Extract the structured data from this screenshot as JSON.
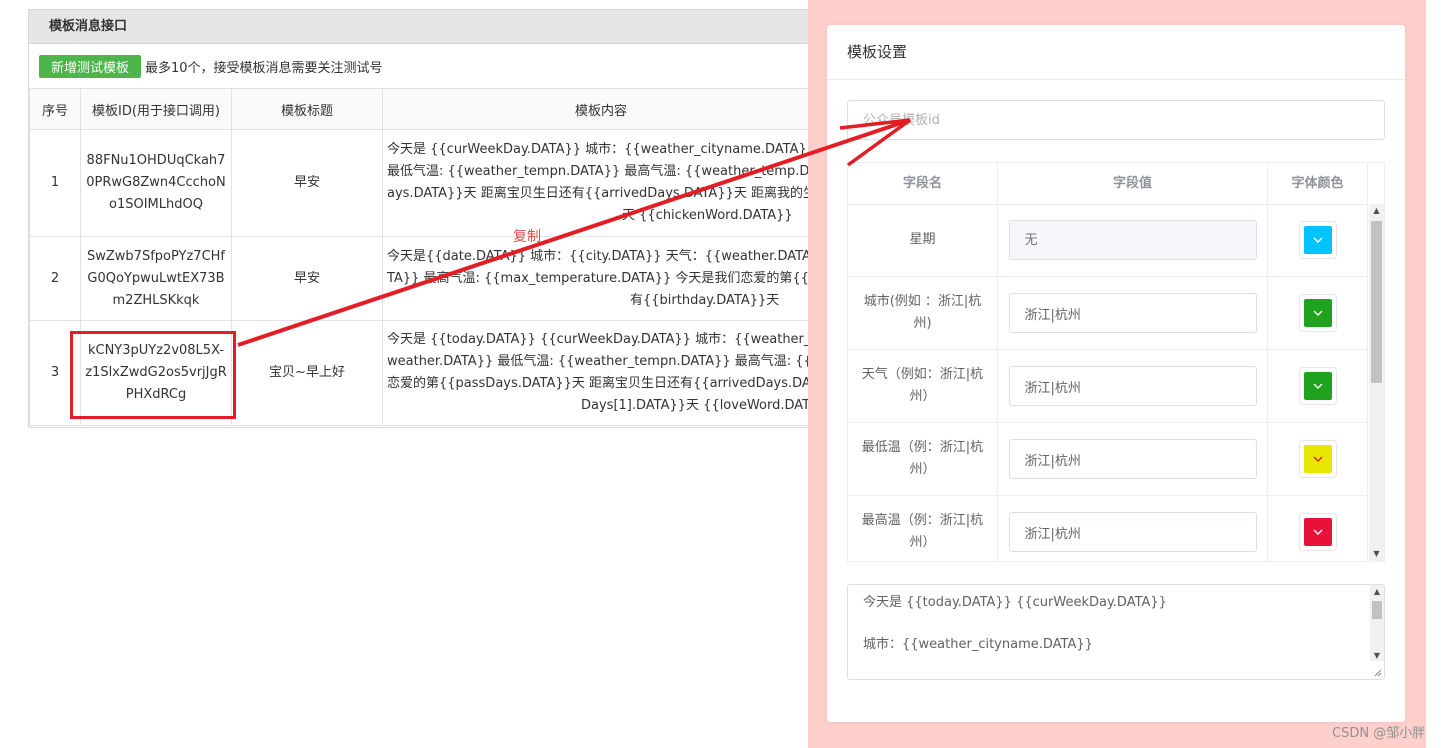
{
  "left": {
    "title": "模板消息接口",
    "add_button": "新增测试模板",
    "tip": "最多10个，接受模板消息需要关注测试号",
    "columns": [
      "序号",
      "模板ID(用于接口调用)",
      "模板标题",
      "模板内容"
    ],
    "rows": [
      {
        "no": "1",
        "id": "88FNu1OHDUqCkah70PRwG8Zwn4CcchoNo1SOIMLhdOQ",
        "title": "早安",
        "lines": [
          "今天是 {{curWeekDay.DATA}} 城市：{{weather_cityname.DATA}} 天气",
          "最低气温: {{weather_tempn.DATA}} 最高气温: {{weather_temp.DATA",
          "ays.DATA}}天 距离宝贝生日还有{{arrivedDays.DATA}}天 距离我的生日",
          "天 {{chickenWord.DATA}}"
        ]
      },
      {
        "no": "2",
        "id": "SwZwb7SfpoPYz7CHfG0QoYpwuLwtEX73Bm2ZHLSKkqk",
        "title": "早安",
        "lines": [
          "今天是{{date.DATA}} 城市：{{city.DATA}} 天气：{{weather.DATA}} 最",
          "TA}} 最高气温: {{max_temperature.DATA}} 今天是我们恋爱的第{{love",
          "有{{birthday.DATA}}天"
        ]
      },
      {
        "no": "3",
        "id": "kCNY3pUYz2v08L5X-z1SlxZwdG2os5vrjJgRPHXdRCg",
        "title": "宝贝~早上好",
        "lines": [
          "今天是 {{today.DATA}} {{curWeekDay.DATA}} 城市：{{weather_city",
          "weather.DATA}} 最低气温: {{weather_tempn.DATA}} 最高气温: {{we",
          "恋爱的第{{passDays.DATA}}天 距离宝贝生日还有{{arrivedDays.DATA",
          "Days[1].DATA}}天 {{loveWord.DATA"
        ]
      }
    ]
  },
  "annotation": {
    "copy_label": "复制",
    "highlight_color": "#e21d24"
  },
  "modal": {
    "title": "模板设置",
    "template_id_placeholder": "公众号模板id",
    "field_headers": [
      "字段名",
      "字段值",
      "字体颜色"
    ],
    "fields": [
      {
        "name": "星期",
        "value_placeholder": "无",
        "value": "",
        "disabled": true,
        "color": "#00c3ff"
      },
      {
        "name": "城市(例如 ：浙江|杭州)",
        "value": "浙江|杭州",
        "disabled": false,
        "color": "#1fa31f"
      },
      {
        "name": "天气（例如：浙江|杭州）",
        "value": "浙江|杭州",
        "disabled": false,
        "color": "#1fa31f"
      },
      {
        "name": "最低温（例：浙江|杭州）",
        "value": "浙江|杭州",
        "disabled": false,
        "color": "#e6e600"
      },
      {
        "name": "最高温（例：浙江|杭州）",
        "value": "浙江|杭州",
        "disabled": false,
        "color": "#e8113a"
      }
    ],
    "content_lines": [
      "今天是  {{today.DATA}}  {{curWeekDay.DATA}}",
      "城市：{{weather_cityname.DATA}}"
    ]
  },
  "watermark": "CSDN @邹小胖",
  "colors": {
    "overlay": "#ffcfcc",
    "add_button": "#4cb54c",
    "arrow": "#e21d24"
  }
}
